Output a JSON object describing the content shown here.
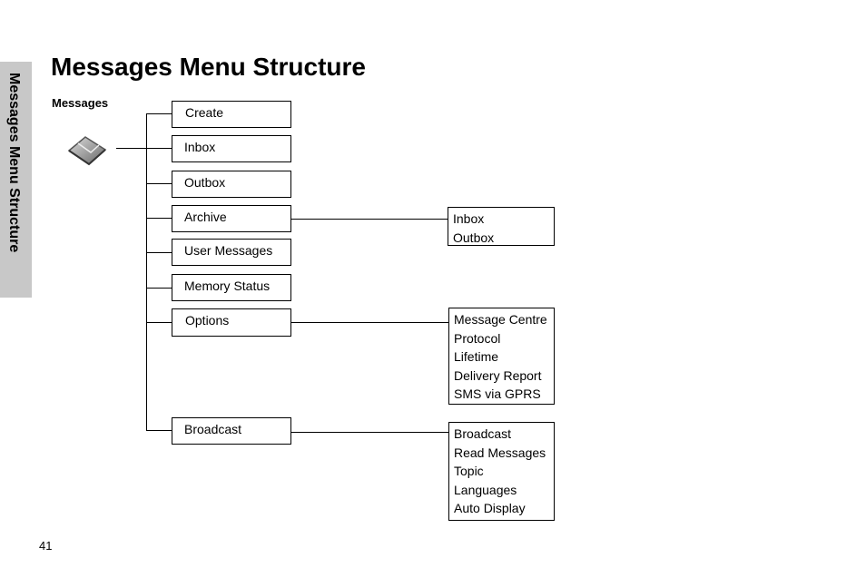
{
  "side_tab": "Messages Menu Structure",
  "title": "Messages Menu Structure",
  "root": {
    "label": "Messages",
    "icon": "envelope-icon"
  },
  "menu": [
    {
      "label": "Create"
    },
    {
      "label": "Inbox"
    },
    {
      "label": "Outbox"
    },
    {
      "label": "Archive",
      "submenu": [
        "Inbox",
        "Outbox"
      ]
    },
    {
      "label": "User Messages"
    },
    {
      "label": "Memory Status"
    },
    {
      "label": "Options",
      "submenu": [
        "Message Centre",
        "Protocol",
        "Lifetime",
        "Delivery Report",
        "SMS via GPRS"
      ]
    },
    {
      "label": "Broadcast",
      "submenu": [
        "Broadcast",
        "Read Messages",
        "Topic",
        "Languages",
        "Auto Display"
      ]
    }
  ],
  "page_number": "41"
}
